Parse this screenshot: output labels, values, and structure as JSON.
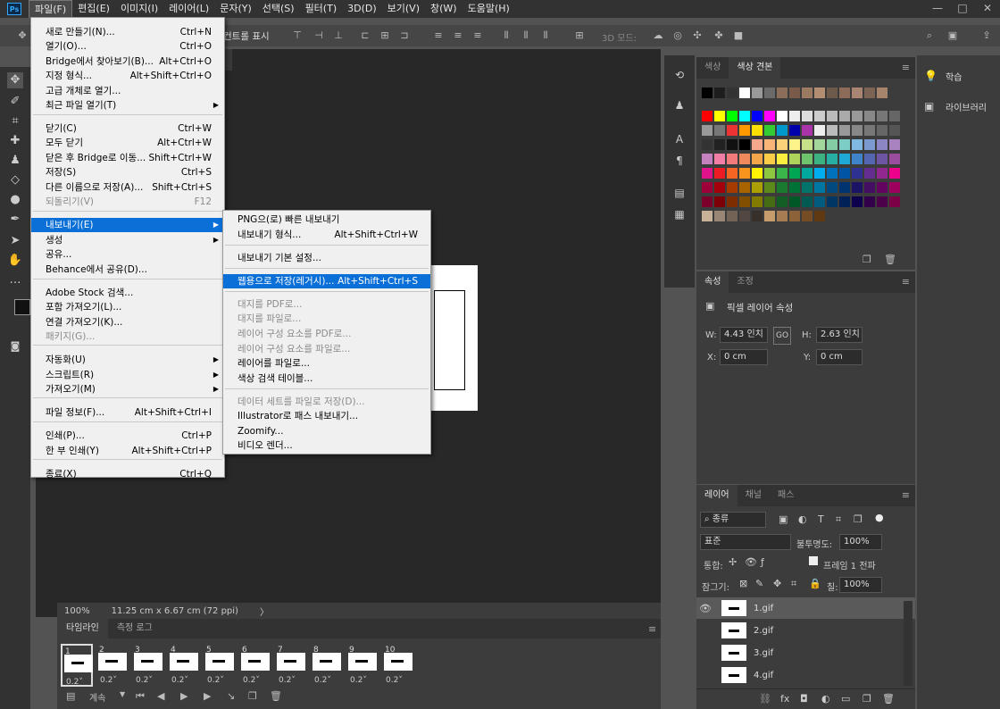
{
  "app": {
    "logo": "Ps"
  },
  "menubar": [
    "파일(F)",
    "편집(E)",
    "이미지(I)",
    "레이어(L)",
    "문자(Y)",
    "선택(S)",
    "필터(T)",
    "3D(D)",
    "보기(V)",
    "창(W)",
    "도움말(H)"
  ],
  "window_controls": [
    "—",
    "□",
    "✕"
  ],
  "options_bar": {
    "transform_label": "컨트롤 표시",
    "mode3d_label": "3D 모드:"
  },
  "file_menu": {
    "items": [
      {
        "label": "새로 만들기(N)...",
        "shortcut": "Ctrl+N"
      },
      {
        "label": "열기(O)...",
        "shortcut": "Ctrl+O"
      },
      {
        "label": "Bridge에서 찾아보기(B)...",
        "shortcut": "Alt+Ctrl+O"
      },
      {
        "label": "지정 형식...",
        "shortcut": "Alt+Shift+Ctrl+O"
      },
      {
        "label": "고급 개체로 열기...",
        "shortcut": ""
      },
      {
        "label": "최근 파일 열기(T)",
        "shortcut": "",
        "submenu": true
      },
      {
        "label": "닫기(C)",
        "shortcut": "Ctrl+W"
      },
      {
        "label": "모두 닫기",
        "shortcut": "Alt+Ctrl+W"
      },
      {
        "label": "닫은 후 Bridge로 이동...",
        "shortcut": "Shift+Ctrl+W"
      },
      {
        "label": "저장(S)",
        "shortcut": "Ctrl+S"
      },
      {
        "label": "다른 이름으로 저장(A)...",
        "shortcut": "Shift+Ctrl+S"
      },
      {
        "label": "되돌리기(V)",
        "shortcut": "F12",
        "disabled": true
      },
      {
        "label": "내보내기(E)",
        "shortcut": "",
        "submenu": true,
        "highlighted": true
      },
      {
        "label": "생성",
        "shortcut": "",
        "submenu": true
      },
      {
        "label": "공유...",
        "shortcut": ""
      },
      {
        "label": "Behance에서 공유(D)...",
        "shortcut": ""
      },
      {
        "label": "Adobe Stock 검색...",
        "shortcut": ""
      },
      {
        "label": "포함 가져오기(L)...",
        "shortcut": ""
      },
      {
        "label": "연결 가져오기(K)...",
        "shortcut": ""
      },
      {
        "label": "패키지(G)...",
        "shortcut": "",
        "disabled": true
      },
      {
        "label": "자동화(U)",
        "shortcut": "",
        "submenu": true
      },
      {
        "label": "스크립트(R)",
        "shortcut": "",
        "submenu": true
      },
      {
        "label": "가져오기(M)",
        "shortcut": "",
        "submenu": true
      },
      {
        "label": "파일 정보(F)...",
        "shortcut": "Alt+Shift+Ctrl+I"
      },
      {
        "label": "인쇄(P)...",
        "shortcut": "Ctrl+P"
      },
      {
        "label": "한 부 인쇄(Y)",
        "shortcut": "Alt+Shift+Ctrl+P"
      },
      {
        "label": "종료(X)",
        "shortcut": "Ctrl+Q"
      }
    ]
  },
  "export_menu": {
    "items": [
      {
        "label": "PNG으(로) 빠른 내보내기",
        "shortcut": ""
      },
      {
        "label": "내보내기 형식...",
        "shortcut": "Alt+Shift+Ctrl+W"
      },
      {
        "label": "내보내기 기본 설정...",
        "shortcut": ""
      },
      {
        "label": "웹용으로 저장(레거시)...",
        "shortcut": "Alt+Shift+Ctrl+S",
        "highlighted": true
      },
      {
        "label": "대지를 PDF로...",
        "shortcut": "",
        "disabled": true
      },
      {
        "label": "대지를 파일로...",
        "shortcut": "",
        "disabled": true
      },
      {
        "label": "레이어 구성 요소를 PDF로...",
        "shortcut": "",
        "disabled": true
      },
      {
        "label": "레이어 구성 요소를 파일로...",
        "shortcut": "",
        "disabled": true
      },
      {
        "label": "레이어를 파일로...",
        "shortcut": ""
      },
      {
        "label": "색상 검색 테이블...",
        "shortcut": ""
      },
      {
        "label": "데이터 세트를 파일로 저장(D)...",
        "shortcut": "",
        "disabled": true
      },
      {
        "label": "Illustrator로 패스 내보내기...",
        "shortcut": ""
      },
      {
        "label": "Zoomify...",
        "shortcut": ""
      },
      {
        "label": "비디오 렌더...",
        "shortcut": ""
      }
    ]
  },
  "status": {
    "zoom": "100%",
    "doc_size": "11.25 cm x 6.67 cm (72 ppi)",
    "arrow": "〉"
  },
  "timeline": {
    "tabs": [
      "타임라인",
      "측정 로그"
    ],
    "frames": [
      {
        "num": "1",
        "delay": "0.2",
        "selected": true
      },
      {
        "num": "2",
        "delay": "0.2"
      },
      {
        "num": "3",
        "delay": "0.2"
      },
      {
        "num": "4",
        "delay": "0.2"
      },
      {
        "num": "5",
        "delay": "0.2"
      },
      {
        "num": "6",
        "delay": "0.2"
      },
      {
        "num": "7",
        "delay": "0.2"
      },
      {
        "num": "8",
        "delay": "0.2"
      },
      {
        "num": "9",
        "delay": "0.2"
      },
      {
        "num": "10",
        "delay": "0.2"
      }
    ],
    "loop": "계속"
  },
  "color_panel": {
    "tabs": [
      "색상",
      "색상 견본"
    ],
    "active": 1
  },
  "properties_panel": {
    "tabs": [
      "속성",
      "조정"
    ],
    "title": "픽셀 레이어 속성",
    "w_label": "W:",
    "w_value": "4.43 인치",
    "h_label": "H:",
    "h_value": "2.63 인치",
    "x_label": "X:",
    "x_value": "0 cm",
    "y_label": "Y:",
    "y_value": "0 cm"
  },
  "layers_panel": {
    "tabs": [
      "레이어",
      "채널",
      "패스"
    ],
    "filter": "종류",
    "blend_mode": "표준",
    "opacity_label": "불투명도:",
    "opacity_value": "100%",
    "unify_label": "통합:",
    "propagate_label": "프레임 1 전파",
    "lock_label": "잠그기:",
    "fill_label": "칠:",
    "fill_value": "100%",
    "layers": [
      {
        "name": "1.gif",
        "visible": true,
        "selected": true
      },
      {
        "name": "2.gif",
        "visible": false
      },
      {
        "name": "3.gif",
        "visible": false
      },
      {
        "name": "4.gif",
        "visible": false
      }
    ]
  },
  "library_panel": {
    "items": [
      "학습",
      "라이브러리"
    ]
  }
}
